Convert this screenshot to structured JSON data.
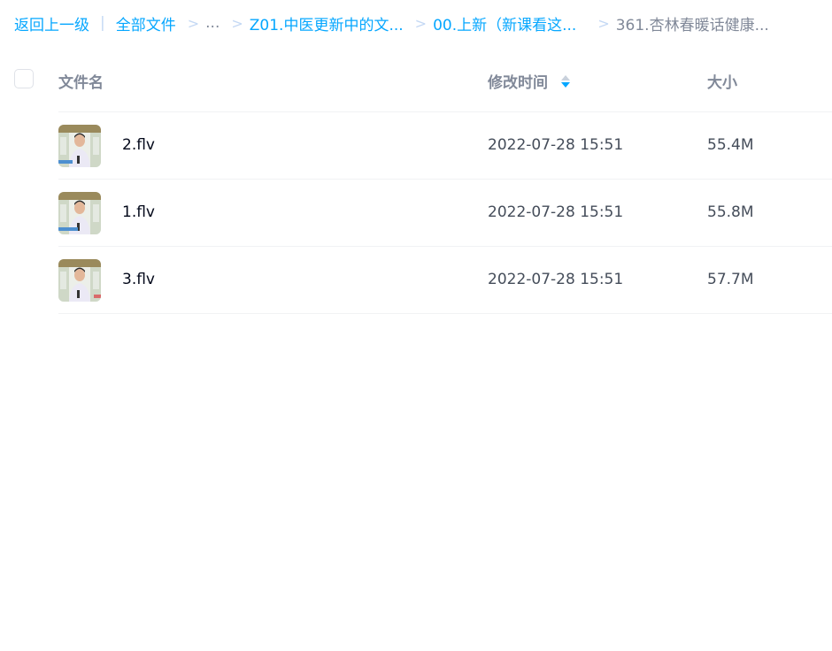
{
  "breadcrumb": {
    "back_label": "返回上一级",
    "divider": "|",
    "root_label": "全部文件",
    "ellipsis": "...",
    "folder1_label": "Z01.中医更新中的文...",
    "folder2_label": "00.上新（新课看这...",
    "current_label": "361.杏林春暖话健康...",
    "separator": ">"
  },
  "table": {
    "headers": {
      "name": "文件名",
      "modified": "修改时间",
      "size": "大小"
    },
    "sort": {
      "column": "modified",
      "direction": "descending"
    },
    "rows": [
      {
        "name": "2.flv",
        "modified": "2022-07-28 15:51",
        "size": "55.4M",
        "thumbnail_icon": "video-thumbnail"
      },
      {
        "name": "1.flv",
        "modified": "2022-07-28 15:51",
        "size": "55.8M",
        "thumbnail_icon": "video-thumbnail"
      },
      {
        "name": "3.flv",
        "modified": "2022-07-28 15:51",
        "size": "57.7M",
        "thumbnail_icon": "video-thumbnail"
      }
    ]
  },
  "colors": {
    "link": "#06a7ff",
    "muted": "#818999",
    "text": "#03081a",
    "secondary_text": "#454d5a"
  }
}
